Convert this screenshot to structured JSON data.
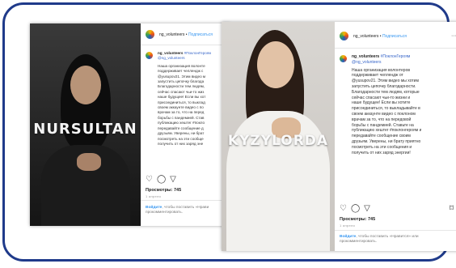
{
  "left_post": {
    "photo_label": "NURSULTAN",
    "account": "ng_volunteers",
    "follow": "Подписаться",
    "caption_user": "ng_volunteers",
    "caption_tag": "#ПоклонГероям",
    "caption_mention": "@ng_volunteers",
    "caption_lines": [
      "Наша организация волонте",
      "поддерживает челлендж с",
      "@yusupov21. Этим видео м",
      "запустить цепочку благода",
      "Благодарности тем людям,",
      "сейчас спасают чьи-то жиз",
      "наше будущее! Если вы хот",
      "присоединиться, то выклад",
      "своем аккаунте видео с по",
      "врачам за то, что на перед",
      "борьбы с пандемией. Став",
      "публикацию хештег #покло",
      "передавайте сообщение д",
      "друзьям. Уверены, ни брат",
      "посмотреть на эти сообще",
      "получить от них заряд эне"
    ],
    "views": "Просмотры: 745",
    "ago": "1 апреля",
    "login_link": "Войдите",
    "login_text": ", чтобы поставить «Нрави",
    "login_text2": "прокомментировать."
  },
  "right_post": {
    "photo_label": "KYZYLORDA",
    "account": "ng_volunteers",
    "follow": "Подписаться",
    "more": "···",
    "caption_user": "ng_volunteers",
    "caption_tag": "#ПоклонГероям",
    "caption_mention": "@ng_volunteers",
    "caption_lines": [
      "Наша организация волонтеров",
      "поддерживает челлендж от",
      "@yusupov21. Этим видео мы хотим",
      "запустить цепочку благодарности.",
      "Благодарности тем людям, которые",
      "сейчас спасают чьи-то жизни и",
      "наше будущее! Если вы хотите",
      "присоединиться, то выкладывайте в",
      "своем аккаунте видео с поклоном",
      "врачам за то, что на передовой",
      "борьбы с пандемией. Ставьте на",
      "публикацию хештег #поклонгероям и",
      "передавайте сообщение своим",
      "друзьям. Уверены, ни брату приятно",
      "посмотреть на эти сообщения и",
      "получить от них заряд энергии!"
    ],
    "views": "Просмотры: 745",
    "ago": "1 апреля",
    "login_link": "Войдите",
    "login_text": ", чтобы поставить «Нравится» или",
    "login_text2": "прокомментировать."
  }
}
